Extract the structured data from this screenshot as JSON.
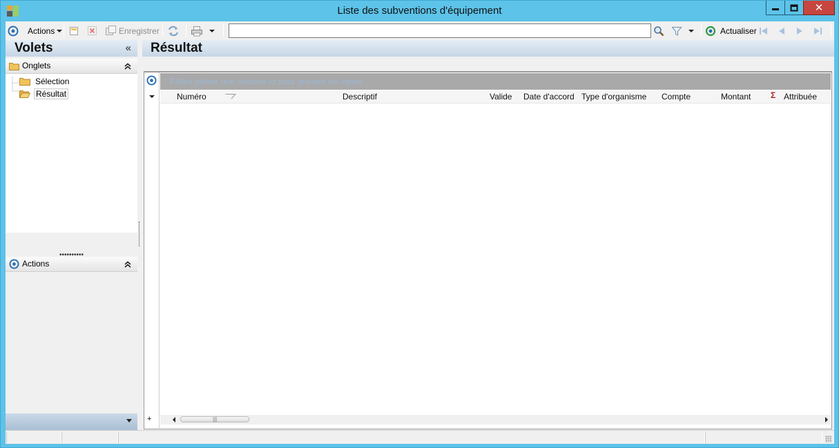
{
  "window": {
    "title": "Liste des subventions d'équipement",
    "controls": {
      "minimize": "minimize",
      "maximize": "maximize",
      "close": "✕"
    }
  },
  "toolbar": {
    "actions_label": "Actions",
    "save_label": "Enregistrer",
    "search": {
      "value": "",
      "placeholder": ""
    },
    "refresh_label": "Actualiser"
  },
  "left_pane": {
    "title": "Volets",
    "collapse_glyph": "«",
    "onglets": {
      "label": "Onglets",
      "items": [
        {
          "label": "Sélection",
          "selected": false
        },
        {
          "label": "Résultat",
          "selected": true
        }
      ]
    },
    "actions": {
      "label": "Actions"
    },
    "splitter_dots": "••••••••••"
  },
  "right_pane": {
    "title": "Résultat",
    "group_band_text": "Faites glisser une colonne ici pour grouper les lignes",
    "columns": [
      "Numéro",
      "Descriptif",
      "Valide",
      "Date d'accord",
      "Type d'organisme",
      "Compte",
      "Montant",
      "Attribuée"
    ],
    "sigma": "Σ"
  },
  "colors": {
    "title_bar": "#5dc3e9",
    "close_button": "#c7463f",
    "header_gradient_top": "#e5edf5",
    "header_gradient_bottom": "#c6d6e6",
    "group_band": "#a9a9a9",
    "accent_blue": "#2a6fb4"
  },
  "icons": {
    "app": "app-grid-icon",
    "options": "ring-icon",
    "new": "new-record-icon",
    "delete": "delete-icon",
    "save": "save-icon",
    "sync": "sync-icon",
    "print": "printer-icon",
    "search": "magnifier-icon",
    "filter": "funnel-icon",
    "refresh": "refresh-icon",
    "nav": [
      "first-record-icon",
      "previous-record-icon",
      "next-record-icon",
      "last-record-icon"
    ]
  }
}
